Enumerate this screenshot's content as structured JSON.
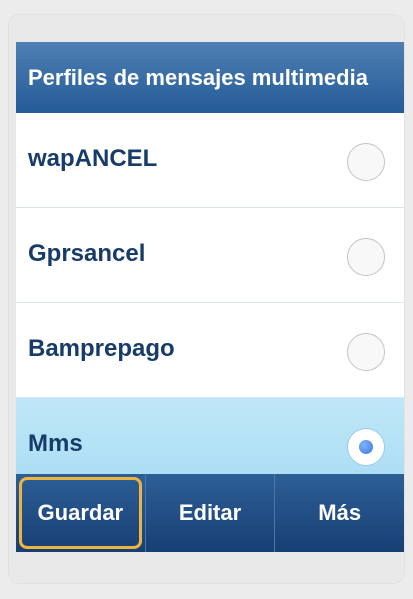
{
  "header": {
    "title": "Perfiles de mensajes multimedia"
  },
  "profiles": {
    "items": [
      {
        "label": "wapANCEL",
        "selected": false
      },
      {
        "label": "Gprsancel",
        "selected": false
      },
      {
        "label": "Bamprepago",
        "selected": false
      },
      {
        "label": "Mms",
        "selected": true
      }
    ]
  },
  "softkeys": {
    "items": [
      {
        "label": "Guardar",
        "focused": true
      },
      {
        "label": "Editar",
        "focused": false
      },
      {
        "label": "Más",
        "focused": false
      }
    ]
  },
  "theme": {
    "header_color": "#245b97",
    "selected_row_color": "#bfe7f8",
    "softbar_color": "#1b4b85",
    "focus_color": "#efb43d"
  }
}
